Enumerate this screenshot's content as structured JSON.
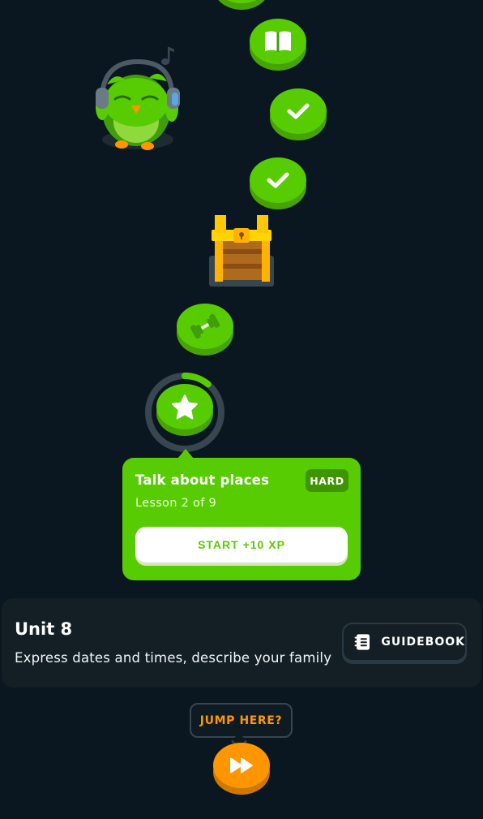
{
  "path": {
    "nodes": [
      {
        "kind": "complete",
        "icon": "check-icon"
      },
      {
        "kind": "story",
        "icon": "book-icon"
      },
      {
        "kind": "complete",
        "icon": "check-icon"
      },
      {
        "kind": "complete",
        "icon": "check-icon"
      },
      {
        "kind": "chest",
        "icon": "treasure-chest-icon"
      },
      {
        "kind": "practice",
        "icon": "dumbbell-icon"
      },
      {
        "kind": "current",
        "icon": "star-icon",
        "progress": 0.11
      }
    ]
  },
  "popup": {
    "title": "Talk about places",
    "subtitle": "Lesson 2 of 9",
    "badge": "HARD",
    "button_label": "START +10 XP"
  },
  "unit": {
    "title": "Unit 8",
    "description": "Express dates and times, describe your family",
    "guidebook_label": "GUIDEBOOK"
  },
  "jump": {
    "tooltip": "JUMP HERE?",
    "icon": "fast-forward-icon"
  },
  "colors": {
    "background": "#0b1720",
    "green": "#58cc02",
    "green_dark": "#46a302",
    "orange": "#ff9600",
    "card": "#131f24"
  }
}
